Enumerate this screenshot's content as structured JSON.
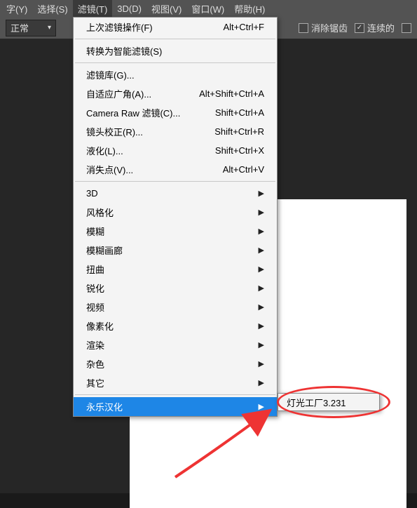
{
  "menubar": {
    "items": [
      {
        "label": "字(Y)"
      },
      {
        "label": "选择(S)"
      },
      {
        "label": "滤镜(T)",
        "active": true
      },
      {
        "label": "3D(D)"
      },
      {
        "label": "视图(V)"
      },
      {
        "label": "窗口(W)"
      },
      {
        "label": "帮助(H)"
      }
    ]
  },
  "toolbar": {
    "mode_label": "正常",
    "antialias_label": "消除锯齿",
    "contiguous_label": "连续的"
  },
  "filter_menu": {
    "group1": [
      {
        "label": "上次滤镜操作(F)",
        "shortcut": "Alt+Ctrl+F"
      }
    ],
    "group2": [
      {
        "label": "转换为智能滤镜(S)",
        "shortcut": ""
      }
    ],
    "group3": [
      {
        "label": "滤镜库(G)...",
        "shortcut": ""
      },
      {
        "label": "自适应广角(A)...",
        "shortcut": "Alt+Shift+Ctrl+A"
      },
      {
        "label": "Camera Raw 滤镜(C)...",
        "shortcut": "Shift+Ctrl+A"
      },
      {
        "label": "镜头校正(R)...",
        "shortcut": "Shift+Ctrl+R"
      },
      {
        "label": "液化(L)...",
        "shortcut": "Shift+Ctrl+X"
      },
      {
        "label": "消失点(V)...",
        "shortcut": "Alt+Ctrl+V"
      }
    ],
    "group4": [
      {
        "label": "3D",
        "submenu": true
      },
      {
        "label": "风格化",
        "submenu": true
      },
      {
        "label": "模糊",
        "submenu": true
      },
      {
        "label": "模糊画廊",
        "submenu": true
      },
      {
        "label": "扭曲",
        "submenu": true
      },
      {
        "label": "锐化",
        "submenu": true
      },
      {
        "label": "视频",
        "submenu": true
      },
      {
        "label": "像素化",
        "submenu": true
      },
      {
        "label": "渲染",
        "submenu": true
      },
      {
        "label": "杂色",
        "submenu": true
      },
      {
        "label": "其它",
        "submenu": true
      }
    ],
    "group5": [
      {
        "label": "永乐汉化",
        "submenu": true,
        "highlight": true
      }
    ]
  },
  "submenu_item": "灯光工厂3.231"
}
